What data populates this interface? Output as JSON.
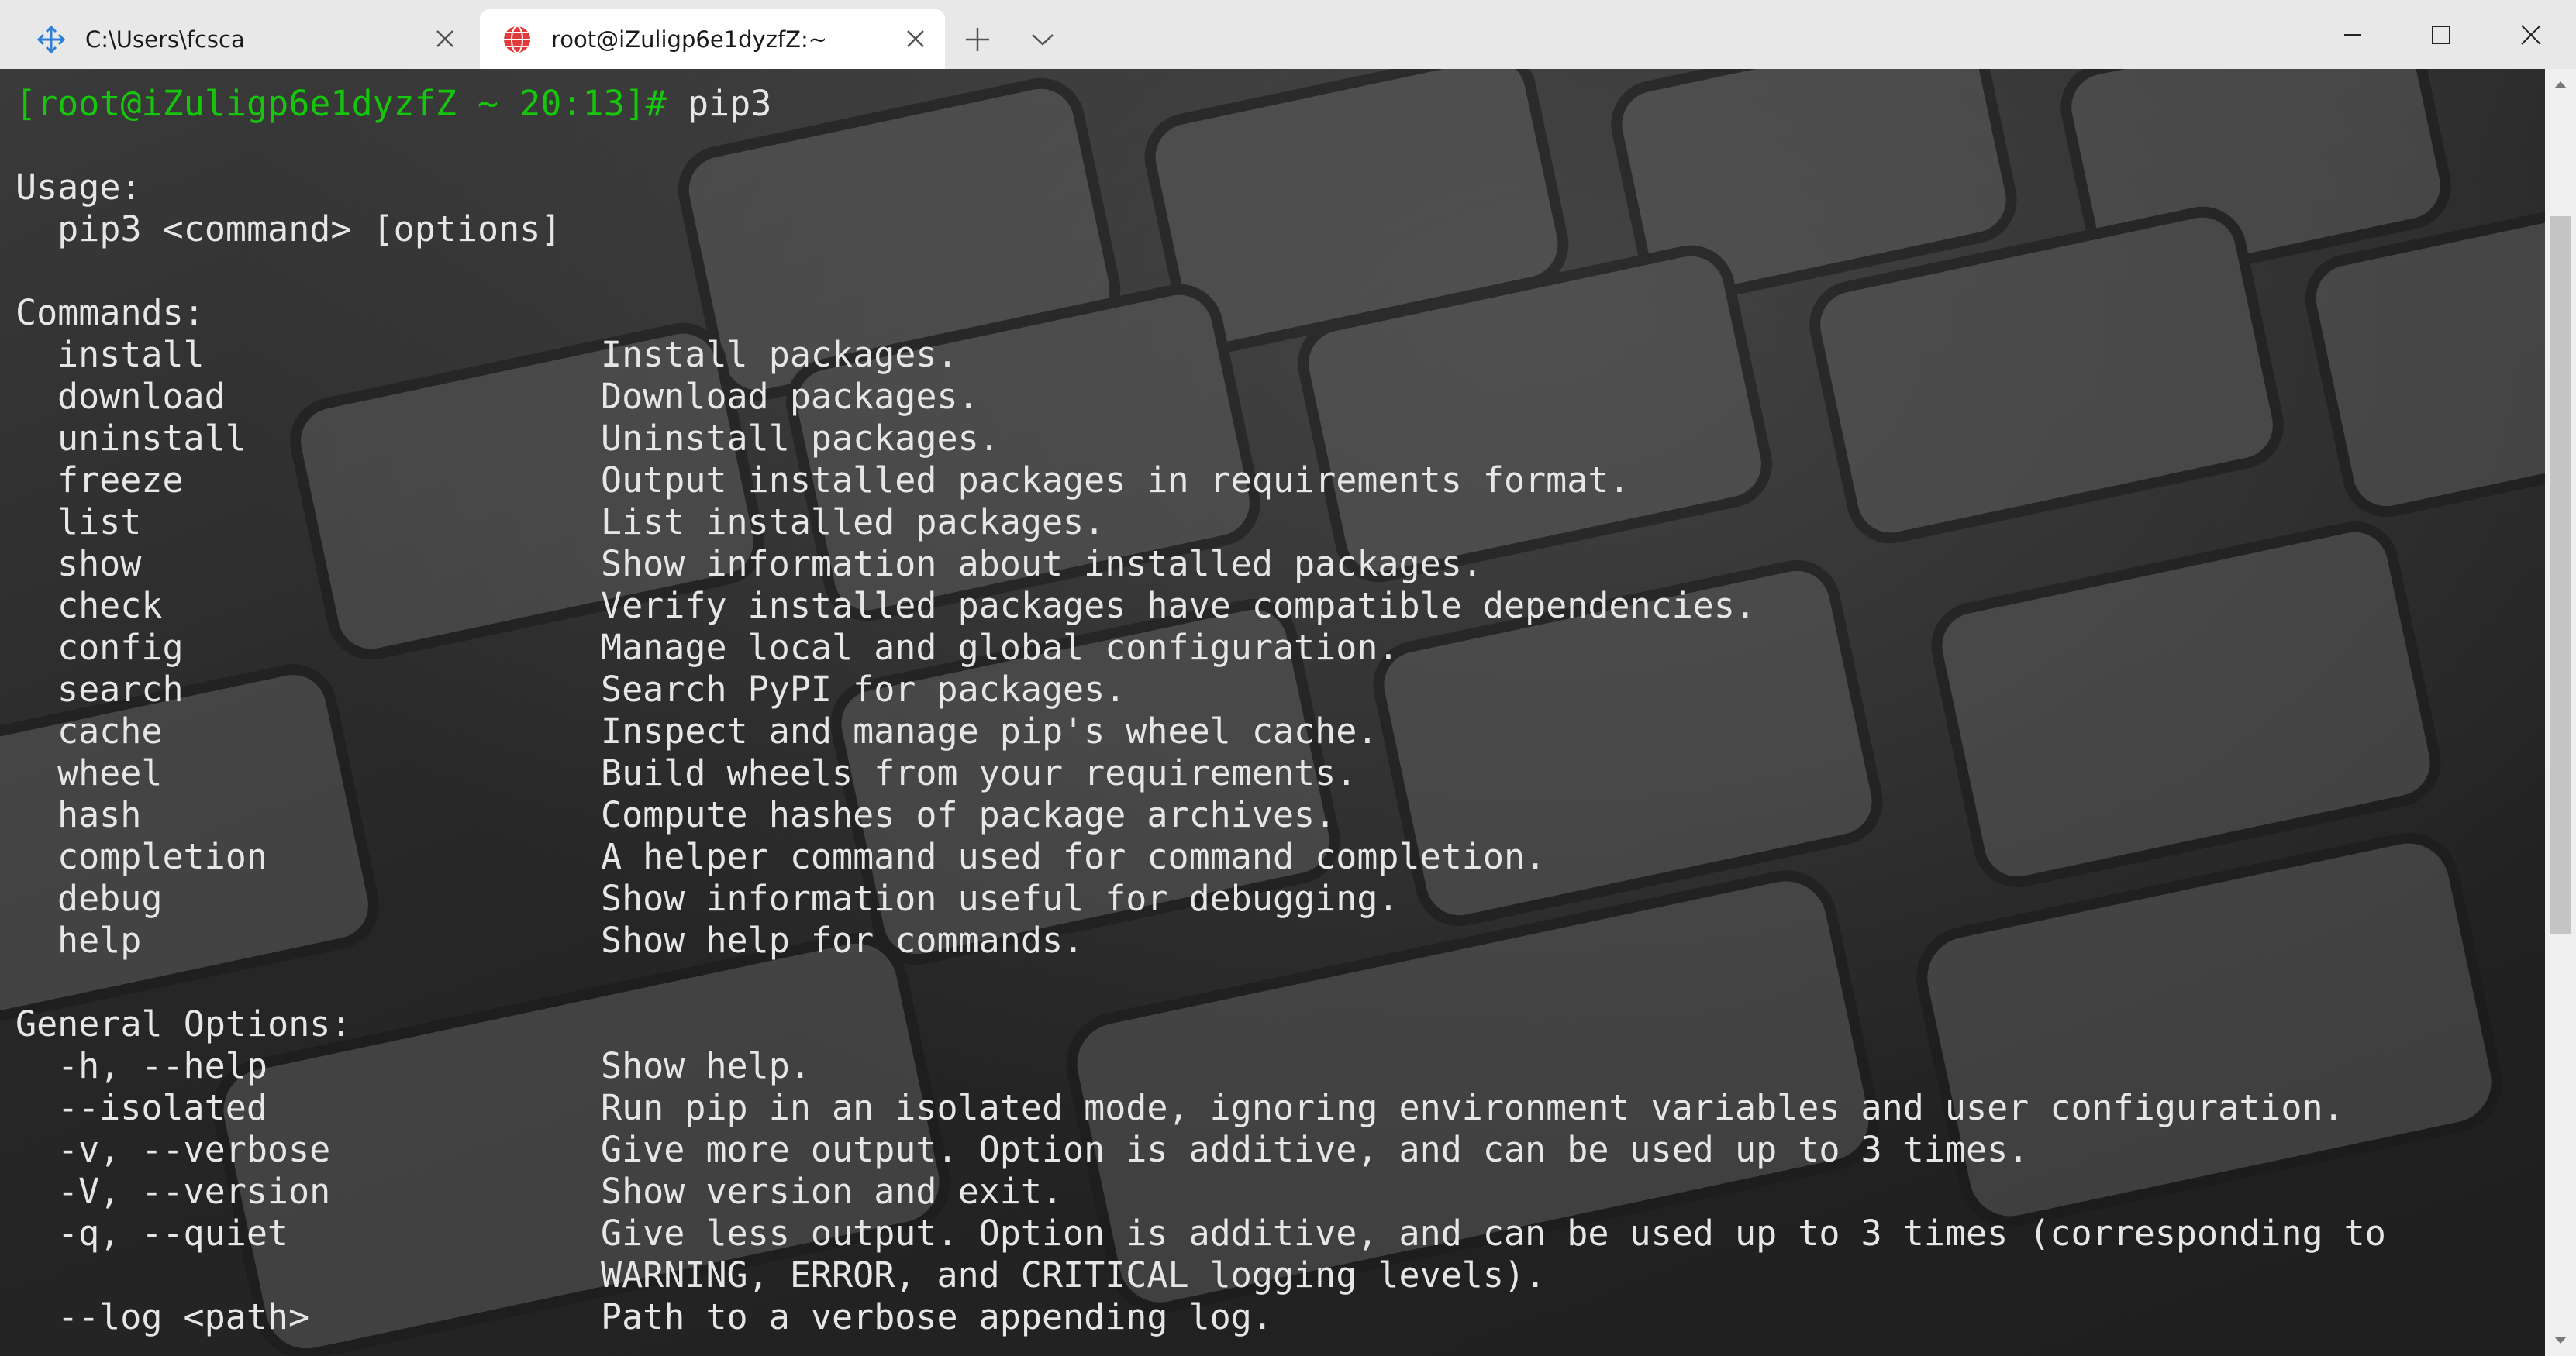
{
  "tabs": [
    {
      "title": "C:\\Users\\fcsca",
      "icon": "azure-cloud-shell-icon"
    },
    {
      "title": "root@iZuligp6e1dyzfZ:~",
      "icon": "globe-icon"
    }
  ],
  "window_controls": {
    "minimize": "minimize-icon",
    "maximize": "maximize-icon",
    "close": "close-icon"
  },
  "terminal": {
    "prompt": "[root@iZuligp6e1dyzfZ ~ 20:13]#",
    "command": " pip3",
    "usage_header": "Usage:",
    "usage_line": "  pip3 <command> [options]",
    "commands_header": "Commands:",
    "commands": [
      {
        "name": "install",
        "desc": "Install packages."
      },
      {
        "name": "download",
        "desc": "Download packages."
      },
      {
        "name": "uninstall",
        "desc": "Uninstall packages."
      },
      {
        "name": "freeze",
        "desc": "Output installed packages in requirements format."
      },
      {
        "name": "list",
        "desc": "List installed packages."
      },
      {
        "name": "show",
        "desc": "Show information about installed packages."
      },
      {
        "name": "check",
        "desc": "Verify installed packages have compatible dependencies."
      },
      {
        "name": "config",
        "desc": "Manage local and global configuration."
      },
      {
        "name": "search",
        "desc": "Search PyPI for packages."
      },
      {
        "name": "cache",
        "desc": "Inspect and manage pip's wheel cache."
      },
      {
        "name": "wheel",
        "desc": "Build wheels from your requirements."
      },
      {
        "name": "hash",
        "desc": "Compute hashes of package archives."
      },
      {
        "name": "completion",
        "desc": "A helper command used for command completion."
      },
      {
        "name": "debug",
        "desc": "Show information useful for debugging."
      },
      {
        "name": "help",
        "desc": "Show help for commands."
      }
    ],
    "options_header": "General Options:",
    "options": [
      {
        "name": "-h, --help",
        "desc": "Show help."
      },
      {
        "name": "--isolated",
        "desc": "Run pip in an isolated mode, ignoring environment variables and user configuration."
      },
      {
        "name": "-v, --verbose",
        "desc": "Give more output. Option is additive, and can be used up to 3 times."
      },
      {
        "name": "-V, --version",
        "desc": "Show version and exit."
      },
      {
        "name": "-q, --quiet",
        "desc": "Give less output. Option is additive, and can be used up to 3 times (corresponding to"
      },
      {
        "name": "",
        "desc": "WARNING, ERROR, and CRITICAL logging levels)."
      },
      {
        "name": "--log <path>",
        "desc": "Path to a verbose appending log."
      }
    ]
  },
  "colors": {
    "prompt": "#16c60c",
    "text": "#e6e6e6",
    "titlebar": "#e8e8e8"
  }
}
